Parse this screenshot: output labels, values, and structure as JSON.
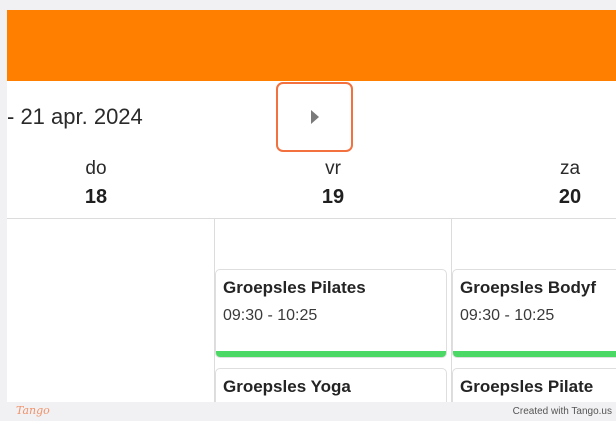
{
  "calendar": {
    "date_range": "- 21 apr. 2024",
    "days": [
      {
        "name": "do",
        "number": "18"
      },
      {
        "name": "vr",
        "number": "19"
      },
      {
        "name": "za",
        "number": "20"
      }
    ],
    "events": {
      "vr": [
        {
          "title": "Groepsles Pilates",
          "time": "09:30 - 10:25"
        },
        {
          "title": "Groepsles Yoga",
          "time": ""
        }
      ],
      "za": [
        {
          "title": "Groepsles Bodyf",
          "time": "09:30 - 10:25"
        },
        {
          "title": "Groepsles Pilate",
          "time": ""
        }
      ]
    },
    "next_icon": "triangle-right-icon"
  },
  "footer": {
    "logo": "Tango",
    "credit": "Created with Tango.us"
  },
  "colors": {
    "header": "#ff8000",
    "highlight": "#f2713f",
    "event_bar": "#4bd865"
  }
}
